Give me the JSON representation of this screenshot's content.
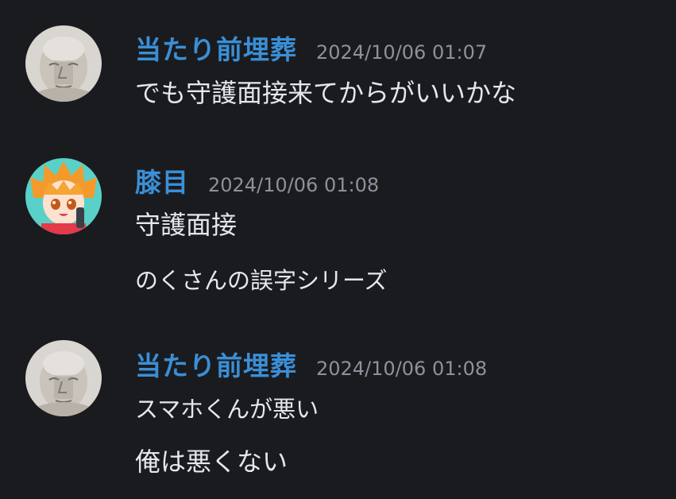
{
  "messages": [
    {
      "username": "当たり前埋葬",
      "timestamp": "2024/10/06 01:07",
      "avatar_icon": "man-face-avatar-icon",
      "lines": [
        "でも守護面接来てからがいいかな"
      ]
    },
    {
      "username": "膝目",
      "timestamp": "2024/10/06 01:08",
      "avatar_icon": "anime-character-avatar-icon",
      "lines": [
        "守護面接",
        "のくさんの誤字シリーズ"
      ]
    },
    {
      "username": "当たり前埋葬",
      "timestamp": "2024/10/06 01:08",
      "avatar_icon": "man-face-avatar-icon",
      "lines": [
        "スマホくんが悪い",
        "俺は悪くない"
      ]
    }
  ],
  "colors": {
    "background": "#1a1b1f",
    "username": "#3a8fd6",
    "timestamp": "#8d919a",
    "text": "#e6e7ea"
  }
}
